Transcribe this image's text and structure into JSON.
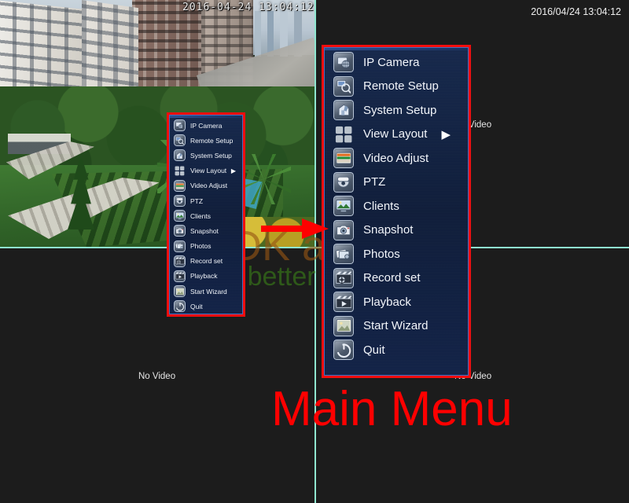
{
  "device": {
    "timestamp_left": "2016-04-24 13:04:12",
    "timestamp_right": "2016/04/24 13:04:12"
  },
  "channels": {
    "top_left": {
      "caption": ""
    },
    "top_right": {
      "caption": "No Video"
    },
    "bottom_left": {
      "caption": "No Video"
    },
    "bottom_right": {
      "caption": "No Video"
    }
  },
  "menu": {
    "title": "Main Menu",
    "items": [
      {
        "label": "IP Camera",
        "icon": "ip-camera-icon",
        "submenu": false
      },
      {
        "label": "Remote Setup",
        "icon": "remote-setup-icon",
        "submenu": false
      },
      {
        "label": "System Setup",
        "icon": "system-setup-icon",
        "submenu": false
      },
      {
        "label": "View Layout",
        "icon": "view-layout-icon",
        "submenu": true
      },
      {
        "label": "Video Adjust",
        "icon": "video-adjust-icon",
        "submenu": false
      },
      {
        "label": "PTZ",
        "icon": "ptz-icon",
        "submenu": false
      },
      {
        "label": "Clients",
        "icon": "clients-icon",
        "submenu": false
      },
      {
        "label": "Snapshot",
        "icon": "snapshot-icon",
        "submenu": false
      },
      {
        "label": "Photos",
        "icon": "photos-icon",
        "submenu": false
      },
      {
        "label": "Record set",
        "icon": "record-set-icon",
        "submenu": false
      },
      {
        "label": "Playback",
        "icon": "playback-icon",
        "submenu": false
      },
      {
        "label": "Start Wizard",
        "icon": "start-wizard-icon",
        "submenu": false
      },
      {
        "label": "Quit",
        "icon": "quit-icon",
        "submenu": false
      }
    ],
    "submenu_arrow": "▶"
  },
  "annotations": {
    "callout_label": "Main Menu",
    "arrow": "right-arrow",
    "highlight_color": "#ff0000"
  },
  "watermark": {
    "line1": "ASDK asdk",
    "line2": "To do better for you!",
    "color1": "#965614",
    "color2": "#3a8018"
  },
  "colors": {
    "menu_background": "#102045",
    "menu_border": "#3f6ec0",
    "highlight_red": "#f20d0d",
    "divider": "#8fe6d0",
    "text": "#f2f5fa",
    "screen_background": "#1c1c1c"
  }
}
